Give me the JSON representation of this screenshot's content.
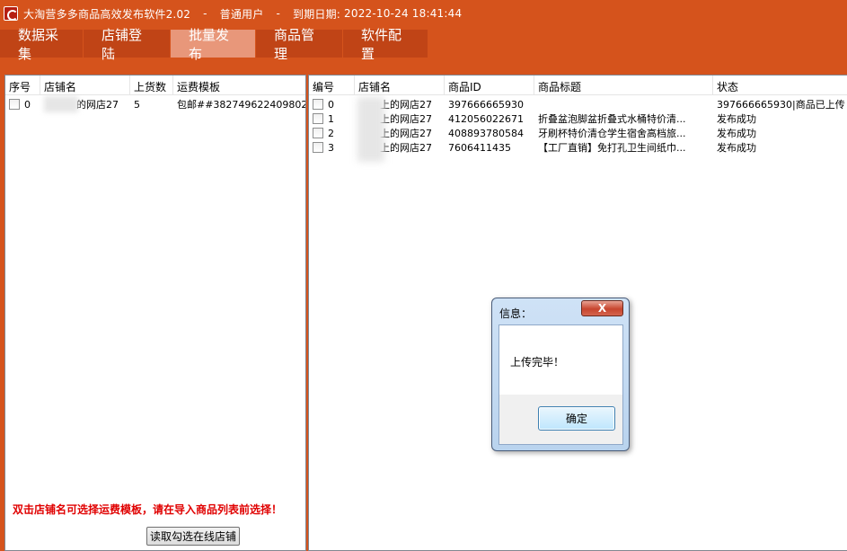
{
  "window": {
    "title": "大淘营多多商品高效发布软件2.02",
    "user_type": "普通用户",
    "expiry_label": "到期日期:",
    "expiry_value": "2022-10-24 18:41:44",
    "separator": "-"
  },
  "tabs": [
    {
      "label": "数据采集",
      "active": false
    },
    {
      "label": "店铺登陆",
      "active": false
    },
    {
      "label": "批量发布",
      "active": true
    },
    {
      "label": "商品管理",
      "active": false
    },
    {
      "label": "软件配置",
      "active": false
    }
  ],
  "left_grid": {
    "headers": [
      "序号",
      "店铺名",
      "上货数",
      "运费模板"
    ],
    "rows": [
      {
        "idx": "0",
        "shop": "的网店27",
        "count": "5",
        "template": "包邮##382749622409802"
      }
    ]
  },
  "right_grid": {
    "headers": [
      "编号",
      "店铺名",
      "商品ID",
      "商品标题",
      "状态"
    ],
    "rows": [
      {
        "idx": "0",
        "shop": "上的网店27",
        "pid": "397666665930",
        "title": "",
        "status": "397666665930|商品已上传"
      },
      {
        "idx": "1",
        "shop": "上的网店27",
        "pid": "412056022671",
        "title": "折叠盆泡脚盆折叠式水桶特价清...",
        "status": "发布成功"
      },
      {
        "idx": "2",
        "shop": "上的网店27",
        "pid": "408893780584",
        "title": "牙刷杯特价清仓学生宿舍高档旅...",
        "status": "发布成功"
      },
      {
        "idx": "3",
        "shop": "上的网店27",
        "pid": "7606411435",
        "title": "【工厂直销】免打孔卫生间纸巾...",
        "status": "发布成功"
      }
    ]
  },
  "hint_text": "双击店铺名可选择运费模板，请在导入商品列表前选择！",
  "read_button": "读取勾选在线店铺",
  "dialog": {
    "title": "信息：",
    "message": "上传完毕！",
    "ok": "确定",
    "close": "X"
  },
  "colors": {
    "background": "#d5531c",
    "active_tab": "#e8977a",
    "tab": "#c04416",
    "hint": "#e00000"
  }
}
